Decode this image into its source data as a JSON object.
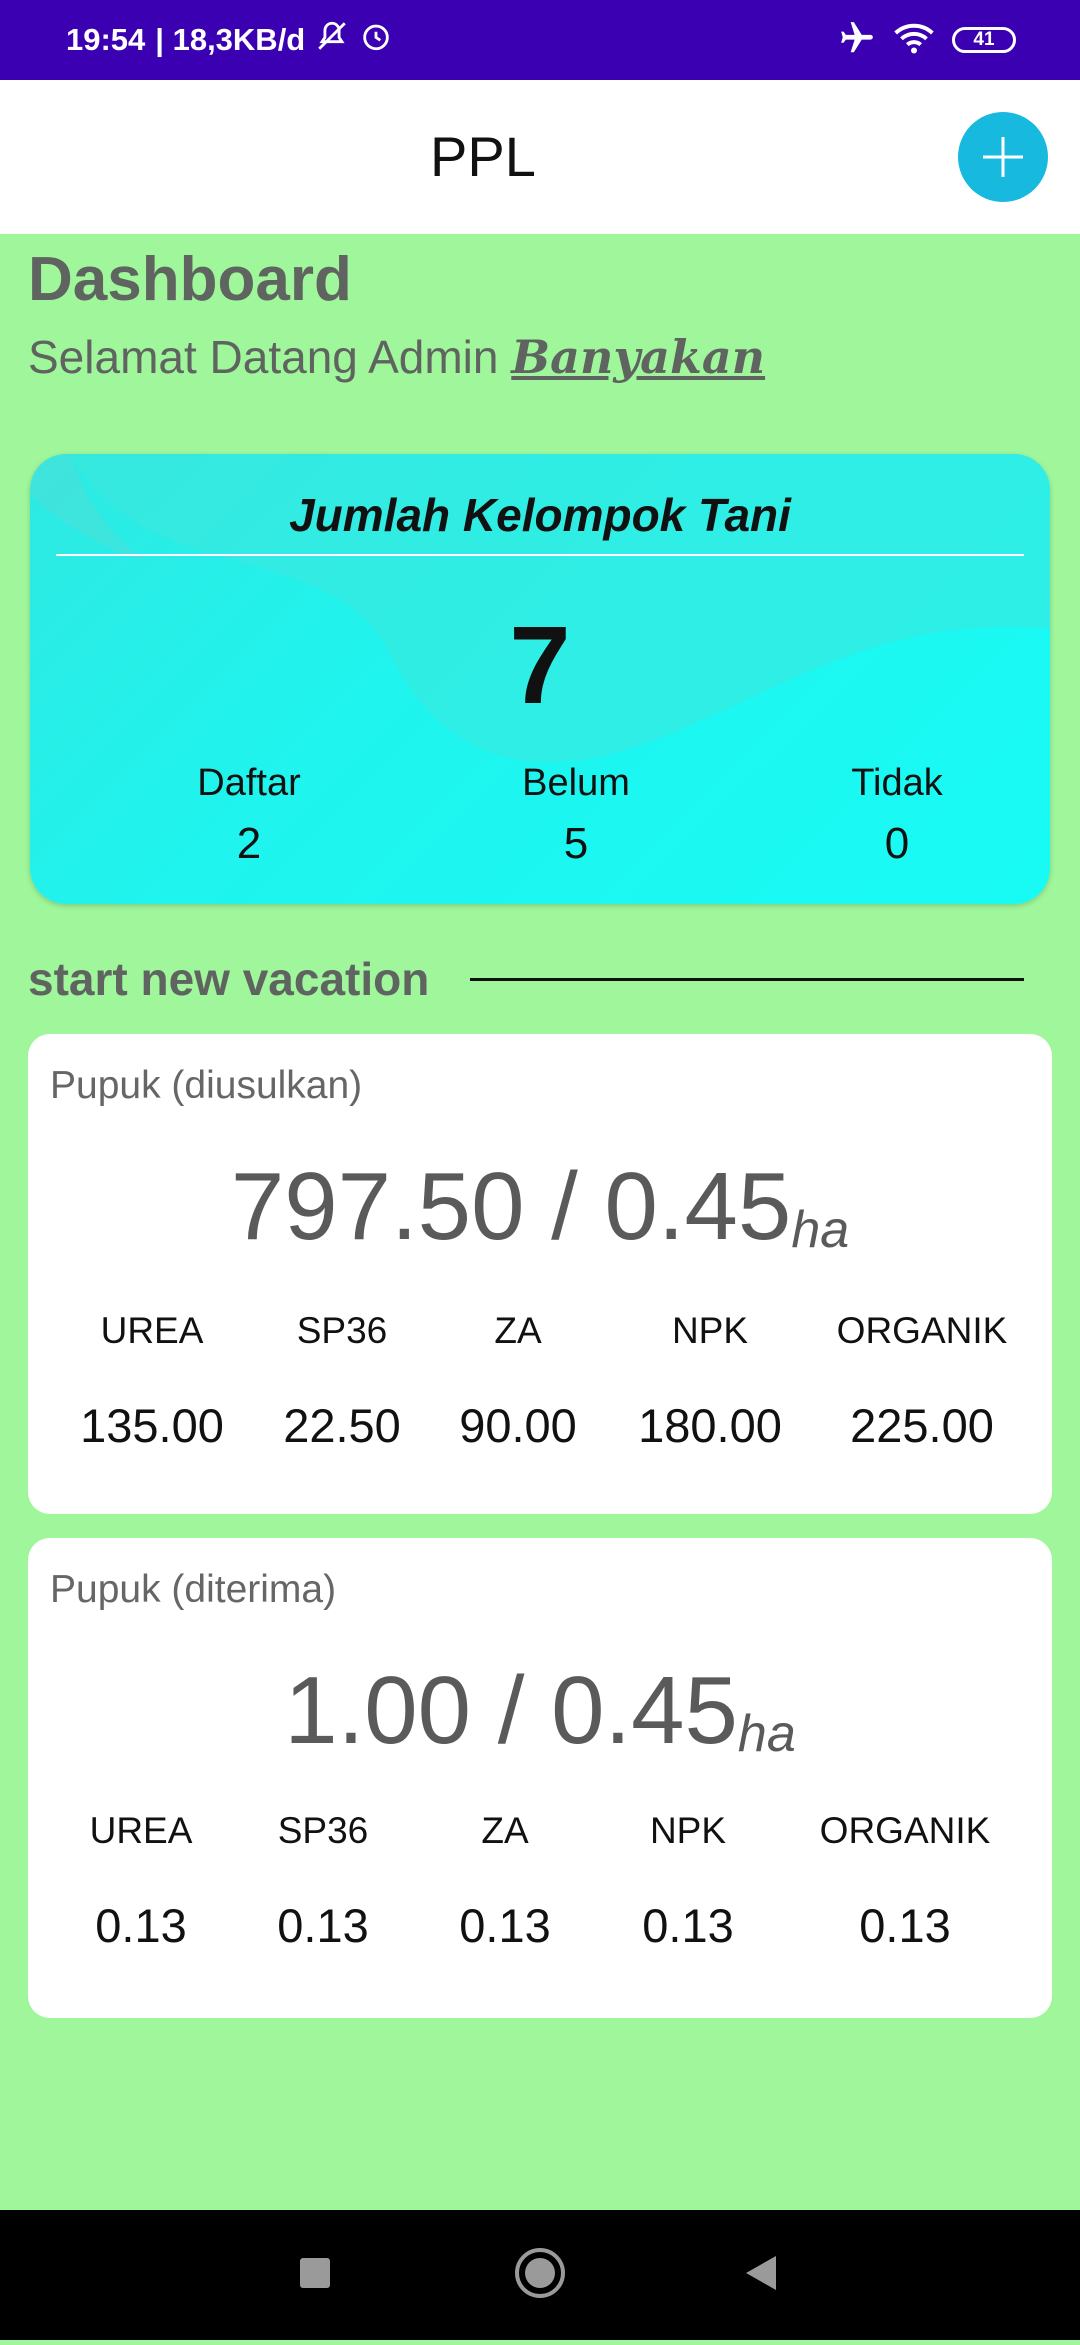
{
  "status_bar": {
    "time": "19:54",
    "speed": "| 18,3KB/d",
    "battery": "41",
    "icons": [
      "mute-icon",
      "alarm-icon",
      "airplane-icon",
      "wifi-icon",
      "battery-icon"
    ]
  },
  "app_bar": {
    "title": "PPL",
    "add_icon": "plus-icon"
  },
  "header": {
    "title": "Dashboard",
    "welcome": "Selamat Datang Admin",
    "username": "Banyakan"
  },
  "tani_card": {
    "title": "Jumlah Kelompok Tani",
    "total": "7",
    "stats": [
      {
        "label": "Daftar",
        "value": "2"
      },
      {
        "label": "Belum",
        "value": "5"
      },
      {
        "label": "Tidak",
        "value": "0"
      }
    ]
  },
  "section": {
    "heading": "start new vacation"
  },
  "pupuk_cards": [
    {
      "label": "Pupuk (diusulkan)",
      "amount": "797.50 / 0.45",
      "unit": "ha",
      "columns": [
        {
          "name": "UREA",
          "value": "135.00"
        },
        {
          "name": "SP36",
          "value": "22.50"
        },
        {
          "name": "ZA",
          "value": "90.00"
        },
        {
          "name": "NPK",
          "value": "180.00"
        },
        {
          "name": "ORGANIK",
          "value": "225.00"
        }
      ]
    },
    {
      "label": "Pupuk (diterima)",
      "amount": "1.00 / 0.45",
      "unit": "ha",
      "columns": [
        {
          "name": "UREA",
          "value": "0.13"
        },
        {
          "name": "SP36",
          "value": "0.13"
        },
        {
          "name": "ZA",
          "value": "0.13"
        },
        {
          "name": "NPK",
          "value": "0.13"
        },
        {
          "name": "ORGANIK",
          "value": "0.13"
        }
      ]
    }
  ],
  "colors": {
    "status_bar": "#3a00b2",
    "background": "#a0f79b",
    "fab": "#18b9de",
    "card_cyan": "#18fbf5"
  },
  "nav_bar": {
    "icons": [
      "recents-square-icon",
      "home-circle-icon",
      "back-triangle-icon"
    ]
  }
}
